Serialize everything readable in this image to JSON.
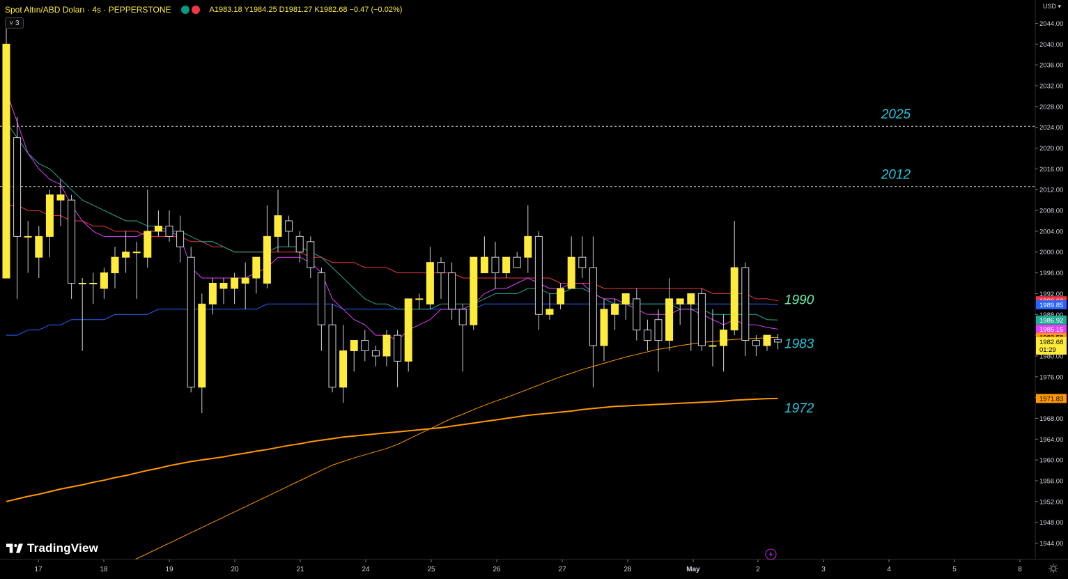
{
  "header": {
    "symbol": "Spot Altın/ABD Doları · 4s · PEPPERSTONE",
    "ohlc": "A1983.18  Y1984.25  D1981.27  K1982.68  −0.47 (−0.02%)",
    "indicator_count": "˅ 3",
    "currency": "USD ▾"
  },
  "branding": {
    "logo_text": "TradingView"
  },
  "colors": {
    "background": "#000000",
    "bull": "#ffeb3b",
    "bear": "#000000",
    "wick": "#d1d4dc",
    "ma_red": "#f23645",
    "ma_blue": "#2962ff",
    "ma_green": "#22ab94",
    "ma_magenta": "#e040fb",
    "ma_orange": "#ff9800",
    "level_teal": "#26c6da",
    "level_green": "#69f0ae"
  },
  "chart_data": {
    "type": "candlestick",
    "y_range": [
      1941,
      2047
    ],
    "y_ticks": [
      "2044.00",
      "2040.00",
      "2036.00",
      "2032.00",
      "2028.00",
      "2024.00",
      "2020.00",
      "2016.00",
      "2012.00",
      "2008.00",
      "2004.00",
      "2000.00",
      "1996.00",
      "1992.00",
      "1988.00",
      "1984.00",
      "1980.00",
      "1976.00",
      "1972.00",
      "1968.00",
      "1964.00",
      "1960.00",
      "1956.00",
      "1952.00",
      "1948.00",
      "1944.00"
    ],
    "x_labels": [
      "17",
      "18",
      "19",
      "20",
      "21",
      "24",
      "25",
      "26",
      "27",
      "28",
      "May",
      "2",
      "3",
      "4",
      "5",
      "8"
    ],
    "candles": [
      {
        "o": 1995,
        "h": 2043,
        "l": 2023,
        "c": 2040
      },
      {
        "o": 2022,
        "h": 2026,
        "l": 1991,
        "c": 2003
      },
      {
        "o": 2003,
        "h": 2006,
        "l": 1996,
        "c": 2003
      },
      {
        "o": 1999,
        "h": 2005,
        "l": 1995,
        "c": 2003
      },
      {
        "o": 2003,
        "h": 2012,
        "l": 1999,
        "c": 2011
      },
      {
        "o": 2010,
        "h": 2014,
        "l": 2005,
        "c": 2011
      },
      {
        "o": 2010,
        "h": 2011,
        "l": 1991,
        "c": 1994
      },
      {
        "o": 1994,
        "h": 1995,
        "l": 1981,
        "c": 1994
      },
      {
        "o": 1994,
        "h": 1996,
        "l": 1990,
        "c": 1994
      },
      {
        "o": 1993,
        "h": 1997,
        "l": 1991,
        "c": 1996
      },
      {
        "o": 1996,
        "h": 2001,
        "l": 1993,
        "c": 1999
      },
      {
        "o": 1999,
        "h": 2004,
        "l": 1996,
        "c": 2000
      },
      {
        "o": 2000,
        "h": 2002,
        "l": 1991,
        "c": 2000
      },
      {
        "o": 1999,
        "h": 2012,
        "l": 1997,
        "c": 2004
      },
      {
        "o": 2004,
        "h": 2008,
        "l": 2003,
        "c": 2005
      },
      {
        "o": 2005,
        "h": 2008,
        "l": 2002,
        "c": 2003
      },
      {
        "o": 2004,
        "h": 2007,
        "l": 1998,
        "c": 2001
      },
      {
        "o": 1999,
        "h": 2001,
        "l": 1973,
        "c": 1974
      },
      {
        "o": 1974,
        "h": 1992,
        "l": 1969,
        "c": 1990
      },
      {
        "o": 1990,
        "h": 1995,
        "l": 1988,
        "c": 1994
      },
      {
        "o": 1993,
        "h": 1995,
        "l": 1990,
        "c": 1994
      },
      {
        "o": 1993,
        "h": 1996,
        "l": 1990,
        "c": 1995
      },
      {
        "o": 1994,
        "h": 1998,
        "l": 1989,
        "c": 1995
      },
      {
        "o": 1995,
        "h": 1999,
        "l": 1992,
        "c": 1999
      },
      {
        "o": 1994,
        "h": 2009,
        "l": 1993,
        "c": 2003
      },
      {
        "o": 2003,
        "h": 2012,
        "l": 2000,
        "c": 2007
      },
      {
        "o": 2006,
        "h": 2007,
        "l": 2001,
        "c": 2004
      },
      {
        "o": 2003,
        "h": 2004,
        "l": 1998,
        "c": 2000
      },
      {
        "o": 2002,
        "h": 2003,
        "l": 1995,
        "c": 1997
      },
      {
        "o": 1996,
        "h": 1997,
        "l": 1981,
        "c": 1986
      },
      {
        "o": 1986,
        "h": 1990,
        "l": 1973,
        "c": 1974
      },
      {
        "o": 1974,
        "h": 1986,
        "l": 1971,
        "c": 1981
      },
      {
        "o": 1981,
        "h": 1983,
        "l": 1977,
        "c": 1983
      },
      {
        "o": 1983,
        "h": 1985,
        "l": 1979,
        "c": 1981
      },
      {
        "o": 1981,
        "h": 1982,
        "l": 1978,
        "c": 1980
      },
      {
        "o": 1980,
        "h": 1985,
        "l": 1978,
        "c": 1984
      },
      {
        "o": 1984,
        "h": 1985,
        "l": 1974,
        "c": 1979
      },
      {
        "o": 1979,
        "h": 1991,
        "l": 1977,
        "c": 1991
      },
      {
        "o": 1991,
        "h": 1992,
        "l": 1989,
        "c": 1991
      },
      {
        "o": 1990,
        "h": 2001,
        "l": 1989,
        "c": 1998
      },
      {
        "o": 1998,
        "h": 1999,
        "l": 1991,
        "c": 1996
      },
      {
        "o": 1996,
        "h": 1998,
        "l": 1987,
        "c": 1989
      },
      {
        "o": 1989,
        "h": 1990,
        "l": 1977,
        "c": 1986
      },
      {
        "o": 1986,
        "h": 1999,
        "l": 1985,
        "c": 1999
      },
      {
        "o": 1996,
        "h": 2003,
        "l": 1996,
        "c": 1999
      },
      {
        "o": 1999,
        "h": 2002,
        "l": 1993,
        "c": 1996
      },
      {
        "o": 1996,
        "h": 1999,
        "l": 1995,
        "c": 1999
      },
      {
        "o": 1999,
        "h": 2000,
        "l": 1997,
        "c": 1997
      },
      {
        "o": 1999,
        "h": 2009,
        "l": 1996,
        "c": 2003
      },
      {
        "o": 2003,
        "h": 2004,
        "l": 1985,
        "c": 1988
      },
      {
        "o": 1988,
        "h": 1992,
        "l": 1987,
        "c": 1989
      },
      {
        "o": 1990,
        "h": 1994,
        "l": 1989,
        "c": 1993
      },
      {
        "o": 1993,
        "h": 2003,
        "l": 1993,
        "c": 1999
      },
      {
        "o": 1999,
        "h": 2003,
        "l": 1995,
        "c": 1997
      },
      {
        "o": 1997,
        "h": 2003,
        "l": 1974,
        "c": 1982
      },
      {
        "o": 1982,
        "h": 1991,
        "l": 1979,
        "c": 1989
      },
      {
        "o": 1988,
        "h": 1991,
        "l": 1985,
        "c": 1990
      },
      {
        "o": 1990,
        "h": 1992,
        "l": 1987,
        "c": 1992
      },
      {
        "o": 1991,
        "h": 1993,
        "l": 1983,
        "c": 1985
      },
      {
        "o": 1985,
        "h": 1987,
        "l": 1981,
        "c": 1983
      },
      {
        "o": 1987,
        "h": 1989,
        "l": 1977,
        "c": 1983
      },
      {
        "o": 1983,
        "h": 1995,
        "l": 1981,
        "c": 1991
      },
      {
        "o": 1990,
        "h": 1991,
        "l": 1986,
        "c": 1991
      },
      {
        "o": 1990,
        "h": 1992,
        "l": 1981,
        "c": 1992
      },
      {
        "o": 1992,
        "h": 1993,
        "l": 1981,
        "c": 1982
      },
      {
        "o": 1982,
        "h": 1989,
        "l": 1978,
        "c": 1982
      },
      {
        "o": 1982,
        "h": 1988,
        "l": 1977,
        "c": 1985
      },
      {
        "o": 1985,
        "h": 2006,
        "l": 1984,
        "c": 1997
      },
      {
        "o": 1997,
        "h": 1998,
        "l": 1980,
        "c": 1983
      },
      {
        "o": 1983,
        "h": 1984,
        "l": 1980,
        "c": 1982
      },
      {
        "o": 1982,
        "h": 1984,
        "l": 1981,
        "c": 1984
      },
      {
        "o": 1983.18,
        "h": 1984.25,
        "l": 1981.27,
        "c": 1982.68
      }
    ],
    "series": [
      {
        "color": "#f23645",
        "values": [
          2009,
          2009,
          2008,
          2008,
          2007,
          2007,
          2006,
          2006,
          2005,
          2005,
          2004,
          2004,
          2004,
          2003,
          2003,
          2003,
          2003,
          2002,
          2002,
          2001,
          2001,
          2000,
          2000,
          2000,
          2000,
          2000,
          2000,
          2000,
          1999,
          1999,
          1998,
          1998,
          1998,
          1997,
          1997,
          1997,
          1996,
          1996,
          1996,
          1996,
          1996,
          1996,
          1995,
          1995,
          1995,
          1995,
          1995,
          1995,
          1995,
          1995,
          1995,
          1994,
          1994,
          1994,
          1994,
          1993,
          1993,
          1993,
          1993,
          1993,
          1993,
          1993,
          1993,
          1993,
          1993,
          1992,
          1992,
          1992,
          1992,
          1991,
          1991,
          1990.62
        ]
      },
      {
        "color": "#2962ff",
        "values": [
          1984,
          1984,
          1985,
          1985,
          1986,
          1986,
          1987,
          1987,
          1987,
          1987,
          1988,
          1988,
          1988,
          1988,
          1989,
          1989,
          1989,
          1989,
          1989,
          1989,
          1989,
          1989,
          1989,
          1989,
          1990,
          1990,
          1990,
          1990,
          1990,
          1990,
          1990,
          1989,
          1989,
          1989,
          1989,
          1989,
          1989,
          1989,
          1989,
          1989,
          1989,
          1989,
          1989,
          1989,
          1990,
          1990,
          1990,
          1990,
          1990,
          1990,
          1990,
          1990,
          1990,
          1990,
          1990,
          1990,
          1990,
          1990,
          1990,
          1990,
          1990,
          1990,
          1990,
          1990,
          1990,
          1990,
          1990,
          1990,
          1990,
          1990,
          1990,
          1989.85
        ]
      },
      {
        "color": "#22ab94",
        "values": [
          2025,
          2022,
          2019,
          2017,
          2016,
          2014,
          2012,
          2010,
          2009,
          2008,
          2007,
          2006,
          2006,
          2005,
          2005,
          2004,
          2004,
          2003,
          2002,
          2002,
          2001,
          2000,
          2000,
          2000,
          2000,
          2001,
          2001,
          2001,
          2000,
          1999,
          1997,
          1995,
          1993,
          1991,
          1990,
          1990,
          1989,
          1989,
          1989,
          1989,
          1990,
          1990,
          1990,
          1990,
          1991,
          1992,
          1992,
          1992,
          1993,
          1993,
          1992,
          1992,
          1993,
          1993,
          1992,
          1991,
          1990,
          1990,
          1990,
          1990,
          1990,
          1990,
          1989,
          1989,
          1989,
          1988,
          1988,
          1988,
          1988,
          1988,
          1987,
          1986.92
        ]
      },
      {
        "color": "#e040fb",
        "values": [
          2031,
          2025,
          2019,
          2016,
          2014,
          2013,
          2009,
          2006,
          2004,
          2003,
          2003,
          2003,
          2003,
          2004,
          2004,
          2004,
          2003,
          1997,
          1995,
          1995,
          1995,
          1995,
          1995,
          1996,
          1997,
          1999,
          1999,
          1999,
          1998,
          1996,
          1991,
          1989,
          1987,
          1986,
          1984,
          1984,
          1983,
          1985,
          1986,
          1987,
          1989,
          1989,
          1989,
          1990,
          1992,
          1993,
          1993,
          1994,
          1995,
          1994,
          1993,
          1993,
          1994,
          1994,
          1992,
          1991,
          1991,
          1990,
          1989,
          1988,
          1988,
          1988,
          1989,
          1989,
          1988,
          1987,
          1986,
          1987,
          1986,
          1986,
          1985.5,
          1985.15
        ]
      },
      {
        "color": "#ff9800",
        "width": 1,
        "values": [
          null,
          null,
          null,
          null,
          null,
          null,
          null,
          null,
          null,
          null,
          null,
          null,
          null,
          null,
          null,
          null,
          null,
          1946,
          1947,
          1948,
          1949,
          1950,
          1951,
          1952,
          1953,
          1954,
          1955,
          1956,
          1957,
          1958,
          1959,
          1959.7,
          1960.4,
          1961,
          1961.6,
          1962.2,
          1963,
          1964,
          1965,
          1966,
          1967,
          1968,
          1968.8,
          1969.7,
          1970.5,
          1971.3,
          1972,
          1972.8,
          1973.6,
          1974.4,
          1975.2,
          1976,
          1976.7,
          1977.4,
          1978,
          1978.6,
          1979.2,
          1979.8,
          1980.3,
          1980.8,
          1981.3,
          1981.6,
          1982,
          1982.3,
          1982.6,
          1982.8,
          1983,
          1983.2,
          1983.3,
          1983.4,
          1983.5,
          1983.58
        ]
      },
      {
        "color": "#ff9800",
        "width": 2,
        "values": [
          1952,
          1952.5,
          1953,
          1953.4,
          1953.9,
          1954.4,
          1954.8,
          1955.2,
          1955.7,
          1956.1,
          1956.6,
          1957,
          1957.5,
          1958,
          1958.4,
          1958.9,
          1959.3,
          1959.7,
          1960,
          1960.3,
          1960.6,
          1961,
          1961.3,
          1961.7,
          1962,
          1962.4,
          1962.8,
          1963.1,
          1963.5,
          1963.8,
          1964.1,
          1964.4,
          1964.6,
          1964.8,
          1965,
          1965.2,
          1965.4,
          1965.6,
          1965.8,
          1966,
          1966.2,
          1966.5,
          1966.8,
          1967.1,
          1967.4,
          1967.7,
          1968,
          1968.3,
          1968.6,
          1968.8,
          1969,
          1969.2,
          1969.4,
          1969.7,
          1969.9,
          1970.1,
          1970.3,
          1970.4,
          1970.5,
          1970.6,
          1970.7,
          1970.8,
          1970.9,
          1971,
          1971.1,
          1971.2,
          1971.3,
          1971.5,
          1971.6,
          1971.7,
          1971.8,
          1971.83
        ]
      }
    ],
    "price_tags": [
      {
        "label": "1990.62",
        "value": 1990.62,
        "bg": "#f23645",
        "fg": "#ffffff"
      },
      {
        "label": "1989.85",
        "value": 1989.85,
        "bg": "#2962ff",
        "fg": "#ffffff"
      },
      {
        "label": "1986.92",
        "value": 1986.92,
        "bg": "#22ab94",
        "fg": "#ffffff"
      },
      {
        "label": "1985.15",
        "value": 1985.15,
        "bg": "#e040fb",
        "fg": "#ffffff"
      },
      {
        "label": "1983.58",
        "value": 1983.58,
        "bg": "#ff9800",
        "fg": "#000000"
      },
      {
        "label": "1982.68",
        "sublabel": "01:29",
        "value": 1982.68,
        "bg": "#ffeb3b",
        "fg": "#000000"
      },
      {
        "label": "1971.83",
        "value": 1971.83,
        "bg": "#ff9800",
        "fg": "#000000"
      }
    ],
    "horizontal_levels": [
      {
        "value": 2024.2,
        "label": "2025",
        "color": "#26c6da"
      },
      {
        "value": 2012.6,
        "label": "2012",
        "color": "#26c6da"
      }
    ],
    "annotations": [
      {
        "label": "1990",
        "value": 1990.9,
        "color": "#69f0ae"
      },
      {
        "label": "1983",
        "value": 1982.5,
        "color": "#26c6da"
      },
      {
        "label": "1972",
        "value": 1970.1,
        "color": "#26c6da"
      }
    ]
  }
}
